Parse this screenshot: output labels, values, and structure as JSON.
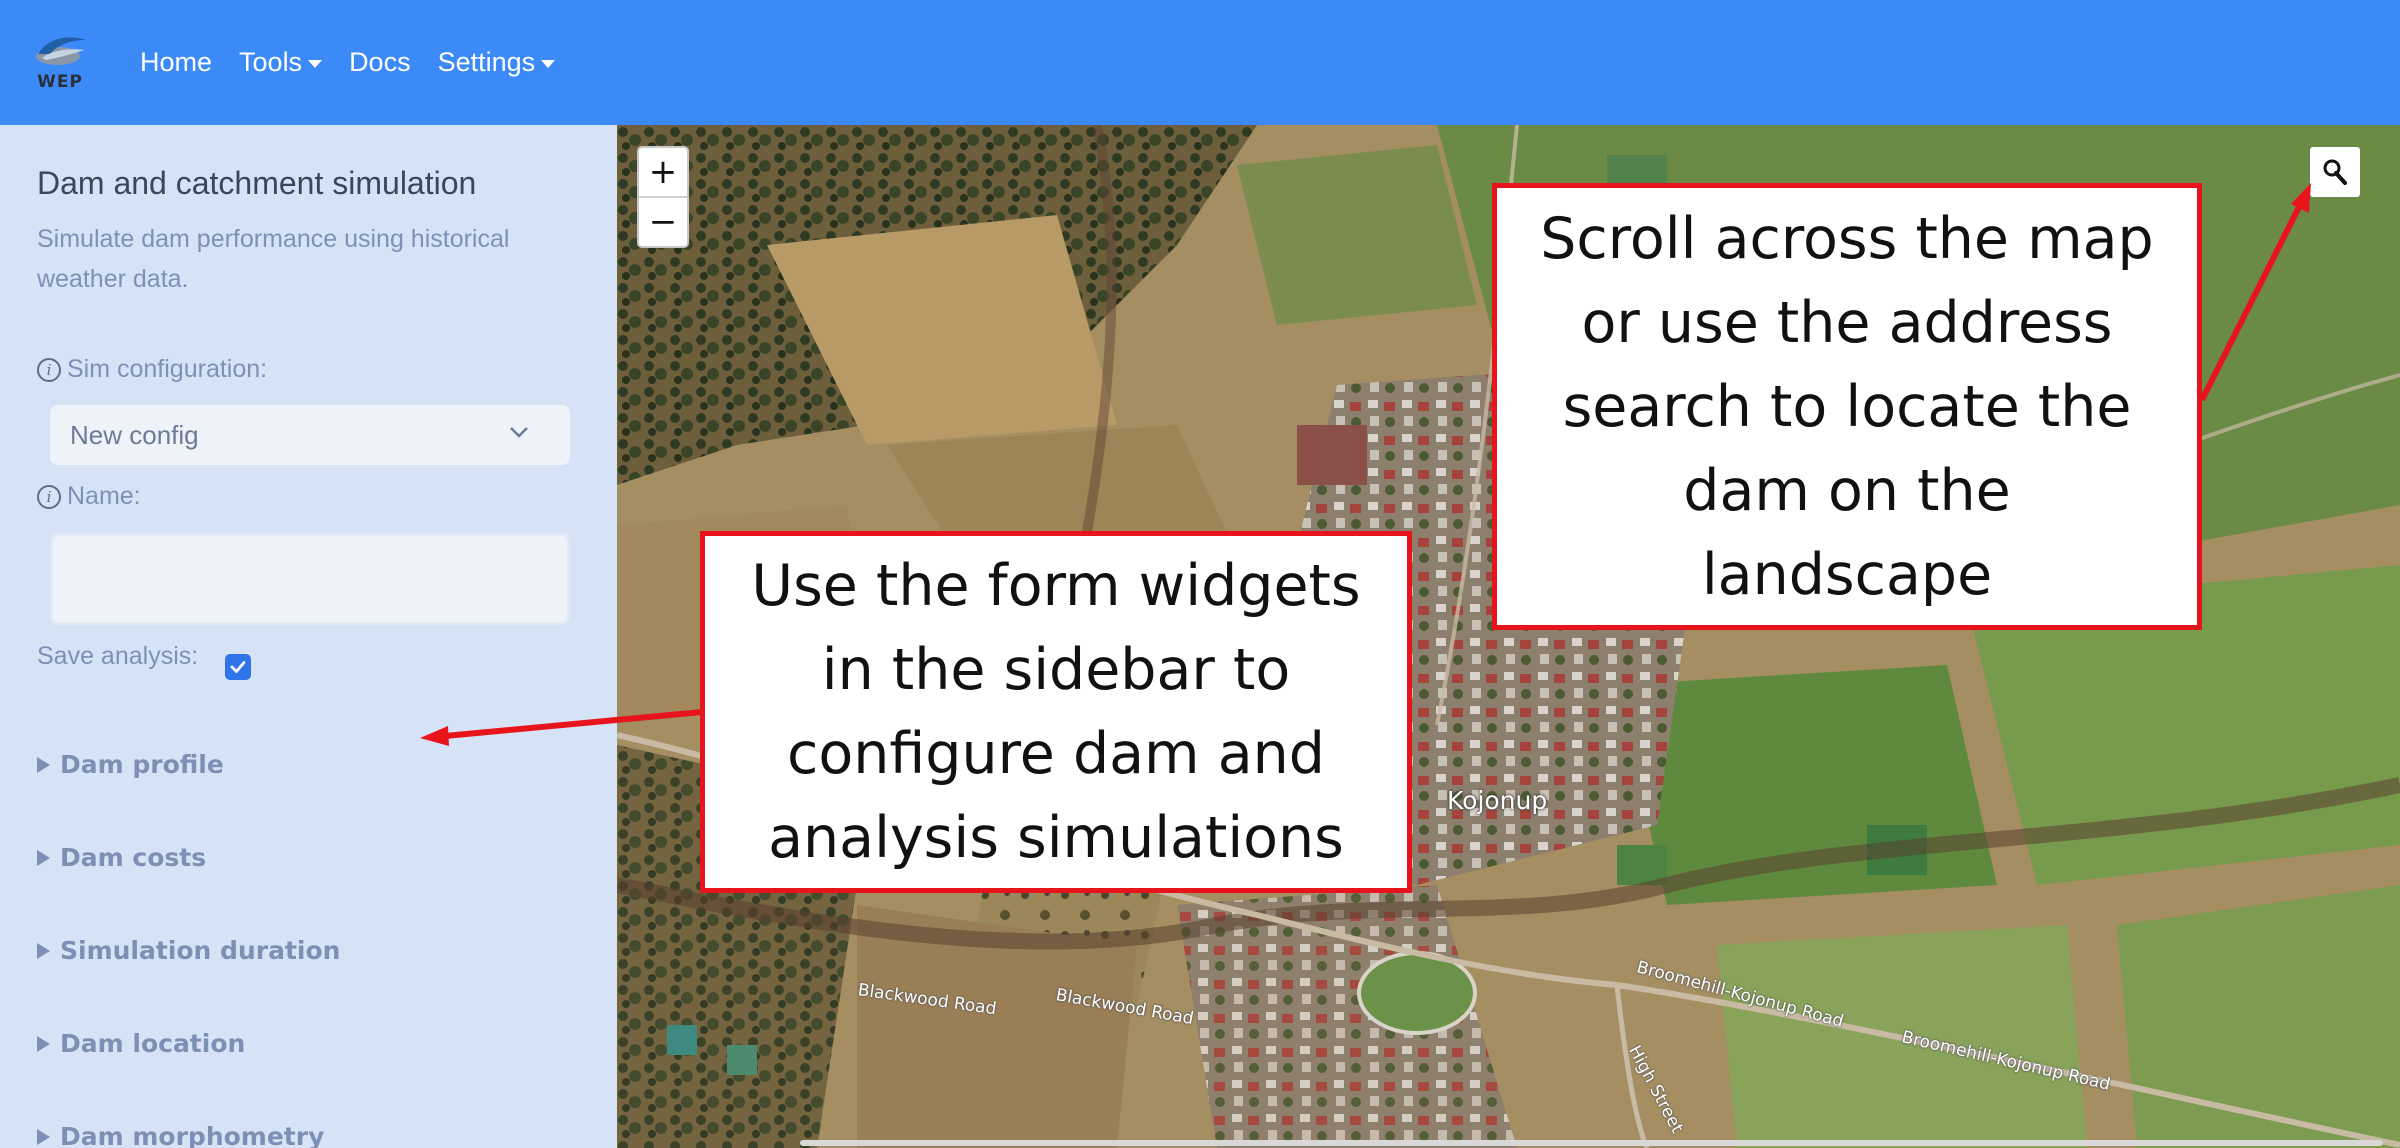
{
  "navbar": {
    "logo_text": "WEP",
    "items": [
      {
        "label": "Home",
        "has_dropdown": false
      },
      {
        "label": "Tools",
        "has_dropdown": true
      },
      {
        "label": "Docs",
        "has_dropdown": false
      },
      {
        "label": "Settings",
        "has_dropdown": true
      }
    ],
    "color": "#3b8af8"
  },
  "sidebar": {
    "title": "Dam and catchment simulation",
    "subtitle": "Simulate dam performance using historical weather data.",
    "sim_config": {
      "label": "Sim configuration:",
      "value": "New config"
    },
    "name": {
      "label": "Name:",
      "value": ""
    },
    "save_analysis": {
      "label": "Save analysis:",
      "checked": true
    },
    "sections": [
      "Dam profile",
      "Dam costs",
      "Simulation duration",
      "Dam location",
      "Dam morphometry"
    ],
    "background": "#d6e3f6"
  },
  "map": {
    "zoom_in": "+",
    "zoom_out": "−",
    "search_icon": "search-icon",
    "place_label": "Kojonup",
    "road_labels": [
      "Blackwood Road",
      "Blackwood Road",
      "Broomehill-Kojonup Road",
      "Broomehill-Kojonup Road",
      "High Street"
    ]
  },
  "callouts": {
    "map_hint": [
      "Scroll across the map",
      "or use the address",
      "search to locate the",
      "dam on the",
      "landscape"
    ],
    "sidebar_hint": [
      "Use the form widgets",
      "in the sidebar to",
      "configure dam and",
      "analysis simulations"
    ],
    "border_color": "#e8141c"
  }
}
